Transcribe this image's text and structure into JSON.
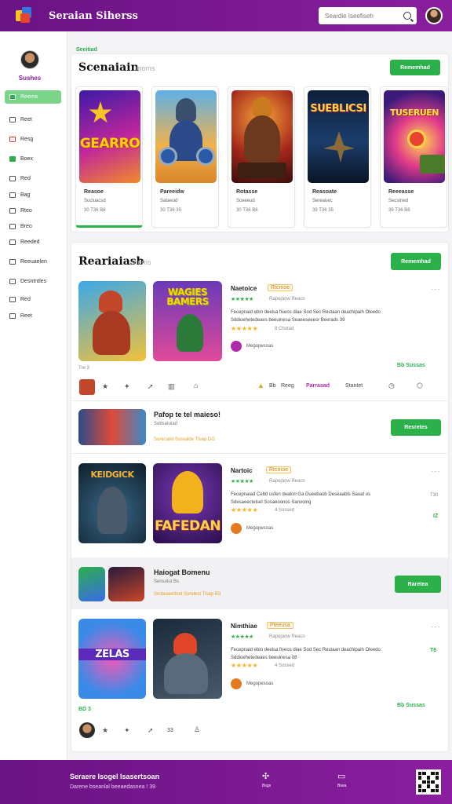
{
  "topbar": {
    "title": "Seraian Siherss",
    "search_placeholder": "Seardie Iseefiseh",
    "logo_icon": "cube-logo-icon",
    "accent": "#7a1a92"
  },
  "sidebar": {
    "user_name": "Sushes",
    "items": [
      {
        "label": "Reems",
        "icon": "home-icon",
        "active": true
      },
      {
        "label": "Reet",
        "icon": "list-icon"
      },
      {
        "label": "Resg",
        "icon": "heart-icon"
      },
      {
        "label": "Boex",
        "icon": "box-icon"
      },
      {
        "label": "Red",
        "icon": "folder-icon"
      },
      {
        "label": "Bag",
        "icon": "bag-icon"
      },
      {
        "label": "Rteo",
        "icon": "tag-icon"
      },
      {
        "label": "Breo",
        "icon": "grid-icon"
      },
      {
        "label": "Reeded",
        "icon": "star-icon"
      },
      {
        "label": "Reeuaelen",
        "icon": "doc-icon"
      },
      {
        "label": "Desntntles",
        "icon": "download-icon"
      },
      {
        "label": "Red",
        "icon": "user-icon"
      },
      {
        "label": "Reet",
        "icon": "settings-icon"
      }
    ]
  },
  "main": {
    "breadcrumb": "Seeitiad",
    "section1": {
      "title": "Scenaiain",
      "subtitle": "moms",
      "button": "Rememhad",
      "cards": [
        {
          "art": "GEARRO",
          "name": "Reasoe",
          "meta1": "Sucluacsd",
          "meta2": "30 T36 B8"
        },
        {
          "art": "",
          "name": "Pareeidw",
          "meta1": "Sataeud",
          "meta2": "30 T36 35"
        },
        {
          "art": "",
          "name": "Rotasse",
          "meta1": "Sceeeud",
          "meta2": "30 T36 B8"
        },
        {
          "art": "SUEBLICSI",
          "name": "Reasoate",
          "meta1": "Sereauec",
          "meta2": "39 T36 35"
        },
        {
          "art": "TUSERUEN",
          "name": "Reeeasse",
          "meta1": "Secstned",
          "meta2": "39 T36 B8"
        }
      ]
    },
    "section2": {
      "title": "Reariaiasb",
      "subtitle": "moms",
      "button": "Rememhad",
      "item1": {
        "art2": "WAGIES BAMERS",
        "name": "Naetoice",
        "tag": "Rtcmoe",
        "rating_label": "Rapupiow Reacn",
        "desc1": "Fecepnaid ebin deeisa fiseos diae Sod Sec Restaan deachipaih Oleedo",
        "desc2": "Sddioehetedeaes beeuinesa Seaeeseeesr Beerads 39",
        "rating_count": "8 Chotad",
        "dev": "Megopesoas",
        "count_left": "Tre 3",
        "green_right": "Bb Sussas",
        "actions": [
          "Bb",
          "Reeg",
          "Parrasad",
          "Stantet"
        ]
      },
      "mini1": {
        "title": "Pafop te tel maieso!",
        "sub": "Sebsatuiad",
        "meta": "Sorecaiet Sorealde Tlsep DG",
        "button": "Resretes"
      },
      "item2": {
        "art1": "KEIDGICK",
        "art2": "FAFEDAN",
        "name": "Nartoic",
        "tag": "Rtcmoe",
        "rating_label": "Rapupiow Reacn",
        "desc1": "Fecepnaiad Cebd usfen deaton Ga Dueebaob Deseaabls Sauat os",
        "desc2": "Sdesaeectelsel Sosaeoonos Sanvoing",
        "rating_count": "4 Sossed",
        "dev": "Megopesoas",
        "side1": "T30",
        "side2": "IZ"
      },
      "mini2": {
        "title": "Haiogat Bomenu",
        "sub": "Sensolut Bs",
        "meta": "Snsteaeeitiod Sorelest Tlsep B3",
        "button": "Raretea"
      },
      "item3": {
        "art1": "ZELAS",
        "name": "Nimthiae",
        "tag": "Pteeusa",
        "rating_label": "Rapupiow Reacn",
        "desc1": "Fecepnaid ebin deeisa fiseos diae Sod Sec Restaan deachipaih Oleedo",
        "desc2": "Sddioehetedeaes beeuinesa 08",
        "rating_count": "4 Sossed",
        "dev": "Megopesoas",
        "side1": "T6",
        "count_left": "BD 3",
        "green_right": "Bb Sussas",
        "action_num": "33"
      }
    }
  },
  "footer": {
    "title": "Seraere Isogel Isasertsoan",
    "sub": "Darene bseanlal beeaedasnea ! 39",
    "icon1_label": "Bsgs",
    "icon2_label": "Bsea"
  }
}
